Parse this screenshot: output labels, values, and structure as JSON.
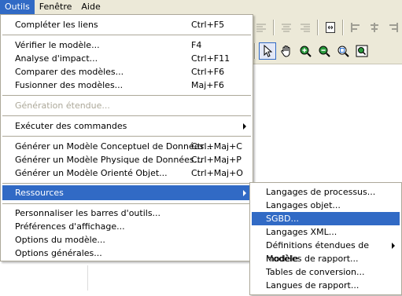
{
  "menubar": {
    "items": [
      {
        "label": "Outils"
      },
      {
        "label": "Fenêtre"
      },
      {
        "label": "Aide"
      }
    ]
  },
  "menu": {
    "items": [
      {
        "label": "Compléter les liens",
        "shortcut": "Ctrl+F5"
      },
      {
        "label": "Vérifier le modèle...",
        "shortcut": "F4"
      },
      {
        "label": "Analyse d'impact...",
        "shortcut": "Ctrl+F11"
      },
      {
        "label": "Comparer des modèles...",
        "shortcut": "Ctrl+F6"
      },
      {
        "label": "Fusionner des modèles...",
        "shortcut": "Maj+F6"
      },
      {
        "label": "Génération étendue...",
        "shortcut": ""
      },
      {
        "label": "Exécuter des commandes",
        "shortcut": ""
      },
      {
        "label": "Générer un Modèle Conceptuel de Données...",
        "shortcut": "Ctrl+Maj+C"
      },
      {
        "label": "Générer un Modèle Physique de Données...",
        "shortcut": "Ctrl+Maj+P"
      },
      {
        "label": "Générer un Modèle Orienté Objet...",
        "shortcut": "Ctrl+Maj+O"
      },
      {
        "label": "Ressources",
        "shortcut": ""
      },
      {
        "label": "Personnaliser les barres d'outils...",
        "shortcut": ""
      },
      {
        "label": "Préférences d'affichage...",
        "shortcut": ""
      },
      {
        "label": "Options du modèle...",
        "shortcut": ""
      },
      {
        "label": "Options générales...",
        "shortcut": ""
      }
    ]
  },
  "submenu": {
    "items": [
      {
        "label": "Langages de processus..."
      },
      {
        "label": "Langages objet..."
      },
      {
        "label": "SGBD..."
      },
      {
        "label": "Langages XML..."
      },
      {
        "label": "Définitions étendues de modèle"
      },
      {
        "label": "Modèles de rapport..."
      },
      {
        "label": "Tables de conversion..."
      },
      {
        "label": "Langues de rapport..."
      }
    ]
  },
  "colors": {
    "highlight": "#316ac5",
    "menu_bg": "#ffffff",
    "chrome": "#ece9d8",
    "disabled_text": "#aca899"
  },
  "toolbar": {
    "icons": [
      "align-left-icon",
      "align-center-icon",
      "align-right-icon",
      "fit-page-icon",
      "align-top-icon",
      "distribute-icon",
      "align-bottom-icon",
      "pointer-icon",
      "hand-icon",
      "zoom-in-icon",
      "zoom-out-icon",
      "zoom-window-icon",
      "zoom-fit-icon"
    ]
  }
}
